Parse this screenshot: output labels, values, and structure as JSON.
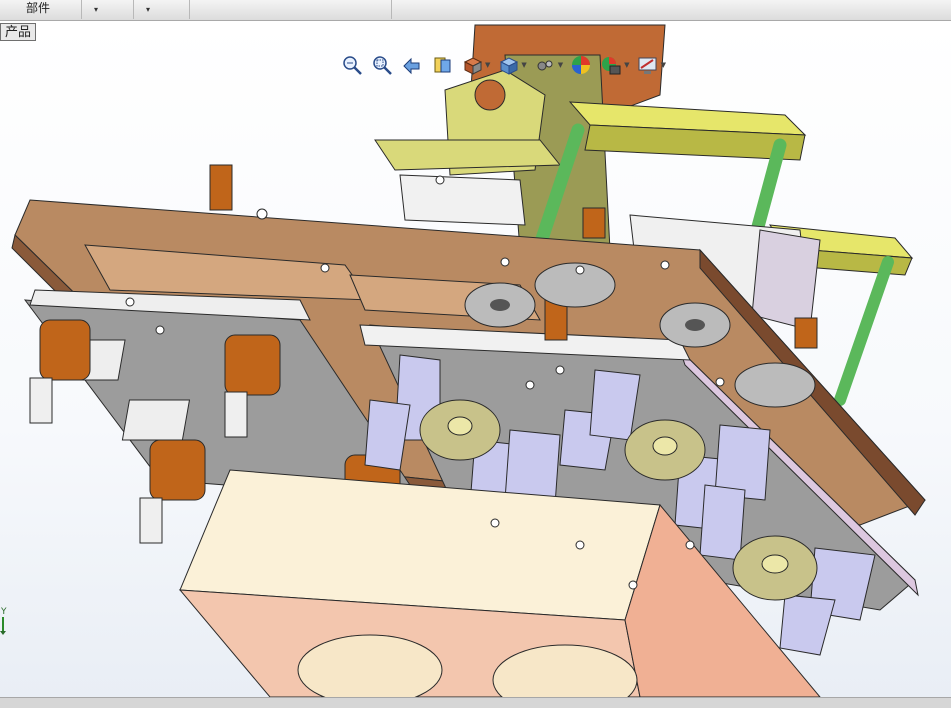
{
  "topbar": {
    "tabs": [
      {
        "label": "部件"
      },
      {
        "label": ""
      },
      {
        "label": ""
      }
    ],
    "caret": "▾"
  },
  "product_tag": "产品",
  "heads_up_toolbar": {
    "buttons": [
      {
        "icon": "zoom-to-fit-icon"
      },
      {
        "icon": "zoom-to-area-icon"
      },
      {
        "icon": "previous-view-icon"
      },
      {
        "icon": "section-view-icon"
      },
      {
        "icon": "view-orientation-icon",
        "dropdown": true
      },
      {
        "icon": "display-style-icon",
        "dropdown": true
      },
      {
        "icon": "hide-show-items-icon",
        "dropdown": true
      },
      {
        "icon": "edit-appearance-icon"
      },
      {
        "icon": "apply-scene-icon",
        "dropdown": true
      },
      {
        "icon": "view-settings-icon",
        "dropdown": true
      }
    ]
  },
  "triad": {
    "axis_label": "Y"
  },
  "colors": {
    "brown_plate": "#b98a62",
    "brown_plate_dark": "#8a5a3a",
    "grey_plate": "#9a9a9a",
    "white_plate": "#ececec",
    "salmon_block": "#f3c6ae",
    "green_rod": "#6bc46b",
    "yellow_bar": "#e6e66a",
    "orange_standoff": "#c0651a",
    "lavender_clamp": "#c9c9ee",
    "olive_gear": "#c8c28a"
  }
}
